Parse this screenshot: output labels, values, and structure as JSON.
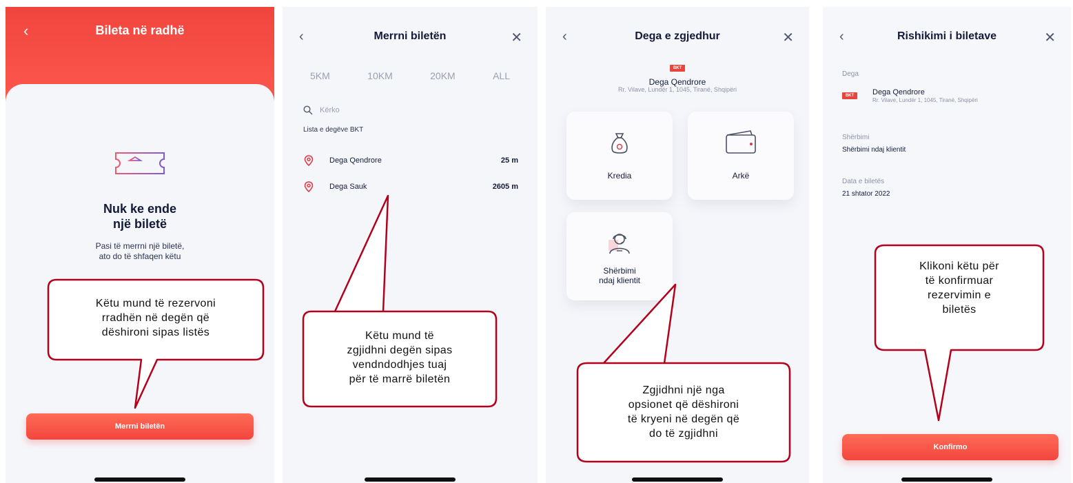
{
  "screen1": {
    "title": "Bileta në radhë",
    "back_icon": "chevron-left-icon",
    "empty_title_line1": "Nuk ke ende",
    "empty_title_line2": "një biletë",
    "empty_sub_line1": "Pasi të merrni një biletë,",
    "empty_sub_line2": "ato do të shfaqen këtu",
    "button": "Merrni biletën",
    "icon_ticket": "bank-ticket-icon"
  },
  "screen2": {
    "title": "Merrni biletën",
    "tabs": [
      "5KM",
      "10KM",
      "20KM",
      "ALL"
    ],
    "search_placeholder": "Kërko",
    "list_label": "Lista e degëve BKT",
    "branches": [
      {
        "name": "Dega Qendrore",
        "distance": "25 m"
      },
      {
        "name": "Dega Sauk",
        "distance": "2605 m"
      }
    ]
  },
  "screen3": {
    "title": "Dega e zgjedhur",
    "logo_text": "BKT",
    "branch_name": "Dega Qendrore",
    "branch_address": "Rr. Vilave, Lundër 1, 1045, Tiranë, Shqipëri",
    "options": [
      {
        "label": "Kredia",
        "icon": "money-bag-icon"
      },
      {
        "label": "Arkë",
        "icon": "wallet-icon"
      },
      {
        "label_line1": "Shërbimi",
        "label_line2": "ndaj klientit",
        "icon": "customer-service-icon"
      }
    ]
  },
  "screen4": {
    "title": "Rishikimi i biletave",
    "branch_label": "Dega",
    "logo_text": "BKT",
    "branch_name": "Dega Qendrore",
    "branch_address": "Rr. Vilave, Lundër 1, 1045, Tiranë, Shqipëri",
    "service_label": "Shërbimi",
    "service_value": "Shërbimi ndaj klientit",
    "date_label": "Data e biletës",
    "date_value": "21 shtator 2022",
    "button": "Konfirmo"
  },
  "callouts": {
    "c1": [
      "Këtu mund të rezervoni",
      "rradhën në degën që",
      "dëshironi sipas listës"
    ],
    "c2": [
      "Këtu mund të",
      "zgjidhni degën sipas",
      "vendndodhjes tuaj",
      "për të marrë biletën"
    ],
    "c3": [
      "Zgjidhni një nga",
      "opsionet që dëshironi",
      "të kryeni në degën që",
      "do të zgjidhni"
    ],
    "c4": [
      "Klikoni këtu për",
      "të konfirmuar",
      "rezervimin e",
      "biletës"
    ]
  },
  "colors": {
    "accent_red": "#f2463f",
    "callout_border": "#b3001b",
    "text_dark": "#141a38"
  }
}
